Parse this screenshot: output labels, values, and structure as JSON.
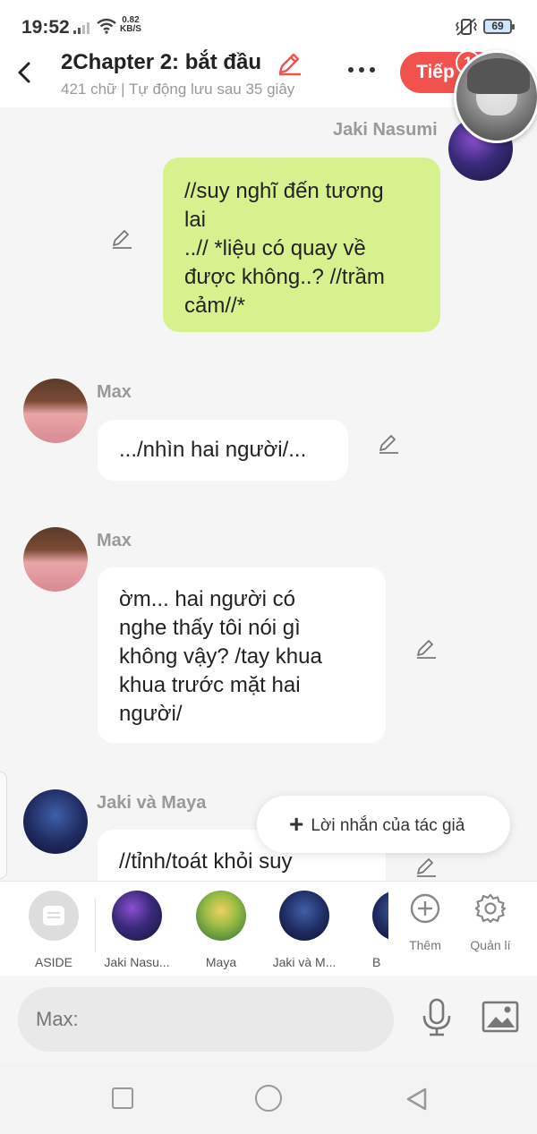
{
  "status_bar": {
    "time": "19:52",
    "net_speed_value": "0.82",
    "net_speed_unit": "KB/S",
    "battery": "69"
  },
  "header": {
    "title": "2Chapter 2: bắt đầu",
    "subtitle": "421 chữ | Tự động lưu sau 35 giây",
    "next_label": "Tiếp",
    "badge_count": "1"
  },
  "messages": [
    {
      "sender": "Jaki Nasumi",
      "side": "right",
      "text_lines": [
        "//suy nghĩ đến tương",
        "lai",
        "..// *liệu có quay về",
        "được không..? //trầm",
        "cảm//*"
      ]
    },
    {
      "sender": "Max",
      "side": "left",
      "text_lines": [
        ".../nhìn hai người/..."
      ]
    },
    {
      "sender": "Max",
      "side": "left",
      "text_lines": [
        "ờm... hai người có",
        "nghe thấy tôi nói gì",
        "không vậy? /tay khua",
        "khua trước mặt hai",
        "người/"
      ]
    },
    {
      "sender": "Jaki và Maya",
      "side": "left",
      "text_lines": [
        "//tỉnh/toát khỏi suy"
      ]
    }
  ],
  "author_note_label": "Lời nhắn của tác giả",
  "characters": [
    {
      "label": "ASIDE"
    },
    {
      "label": "Jaki Nasu..."
    },
    {
      "label": "Maya"
    },
    {
      "label": "Jaki và M..."
    },
    {
      "label": "B"
    }
  ],
  "tools": {
    "add_label": "Thêm",
    "manage_label": "Quản lí"
  },
  "input": {
    "placeholder": "Max:"
  },
  "colors": {
    "accent": "#f2524e",
    "green_bubble": "#d7f18e",
    "background": "#f5f5f5"
  }
}
